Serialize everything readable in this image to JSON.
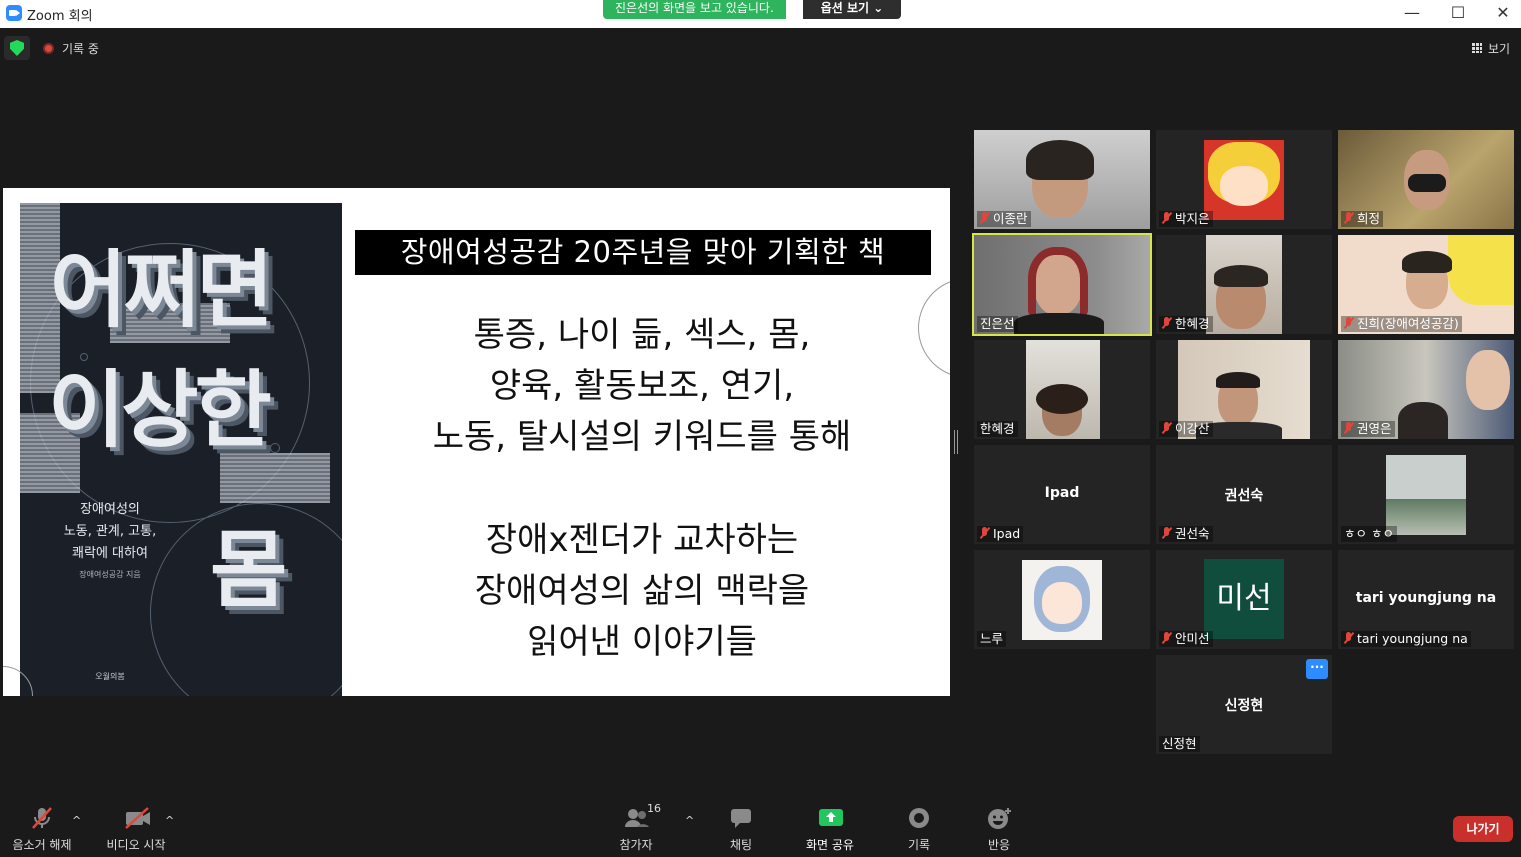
{
  "window": {
    "title": "Zoom 회의"
  },
  "banner": {
    "text": "진은선의 화면을 보고 있습니다.",
    "options_label": "옵션 보기"
  },
  "status": {
    "recording_label": "기록 중",
    "view_label": "보기"
  },
  "slide": {
    "book_title_1": "어쩌면",
    "book_title_2": "이상한",
    "book_title_3": "몸",
    "book_subtitle_1": "장애여성의",
    "book_subtitle_2": "노동, 관계, 고통,",
    "book_subtitle_3": "쾌락에 대하여",
    "book_author": "장애여성공감 지음",
    "book_publisher": "오월의봄",
    "heading": "장애여성공감 20주년을 맞아 기획한 책",
    "lines": [
      "통증, 나이 듦, 섹스, 몸,",
      "양육, 활동보조, 연기,",
      "노동, 탈시설의 키워드를 통해",
      "장애x젠더가 교차하는",
      "장애여성의 삶의 맥락을",
      "읽어낸 이야기들"
    ]
  },
  "participants": [
    {
      "name": "이종란",
      "muted": true
    },
    {
      "name": "박지은",
      "muted": true
    },
    {
      "name": "희정",
      "muted": true
    },
    {
      "name": "진은선",
      "muted": false,
      "active_speaker": true
    },
    {
      "name": "한혜경",
      "muted": true
    },
    {
      "name": "진희(장애여성공감)",
      "muted": true
    },
    {
      "name": "한혜경",
      "muted": false
    },
    {
      "name": "이강산",
      "muted": true
    },
    {
      "name": "권영은",
      "muted": true
    },
    {
      "name": "Ipad",
      "muted": true,
      "display_name": "Ipad"
    },
    {
      "name": "권선숙",
      "muted": true,
      "display_name": "권선숙"
    },
    {
      "name": "ㅎㅇ ㅎㅇ",
      "muted": false
    },
    {
      "name": "느루",
      "muted": false
    },
    {
      "name": "안미선",
      "muted": true,
      "avatar_text": "미선"
    },
    {
      "name": "tari youngjung na",
      "muted": true,
      "display_name": "tari youngjung na"
    },
    {
      "name": "신정현",
      "muted": false,
      "display_name": "신정현"
    }
  ],
  "more_button": "···",
  "toolbar": {
    "unmute": "음소거 해제",
    "start_video": "비디오 시작",
    "participants": "참가자",
    "participant_count": "16",
    "chat": "채팅",
    "share_screen": "화면 공유",
    "record": "기록",
    "reactions": "반응",
    "leave": "나가기"
  },
  "colors": {
    "share_green": "#2fb45e",
    "active_border": "#d6e64a",
    "leave_red": "#c9302c",
    "zoom_blue": "#2d8cff"
  }
}
